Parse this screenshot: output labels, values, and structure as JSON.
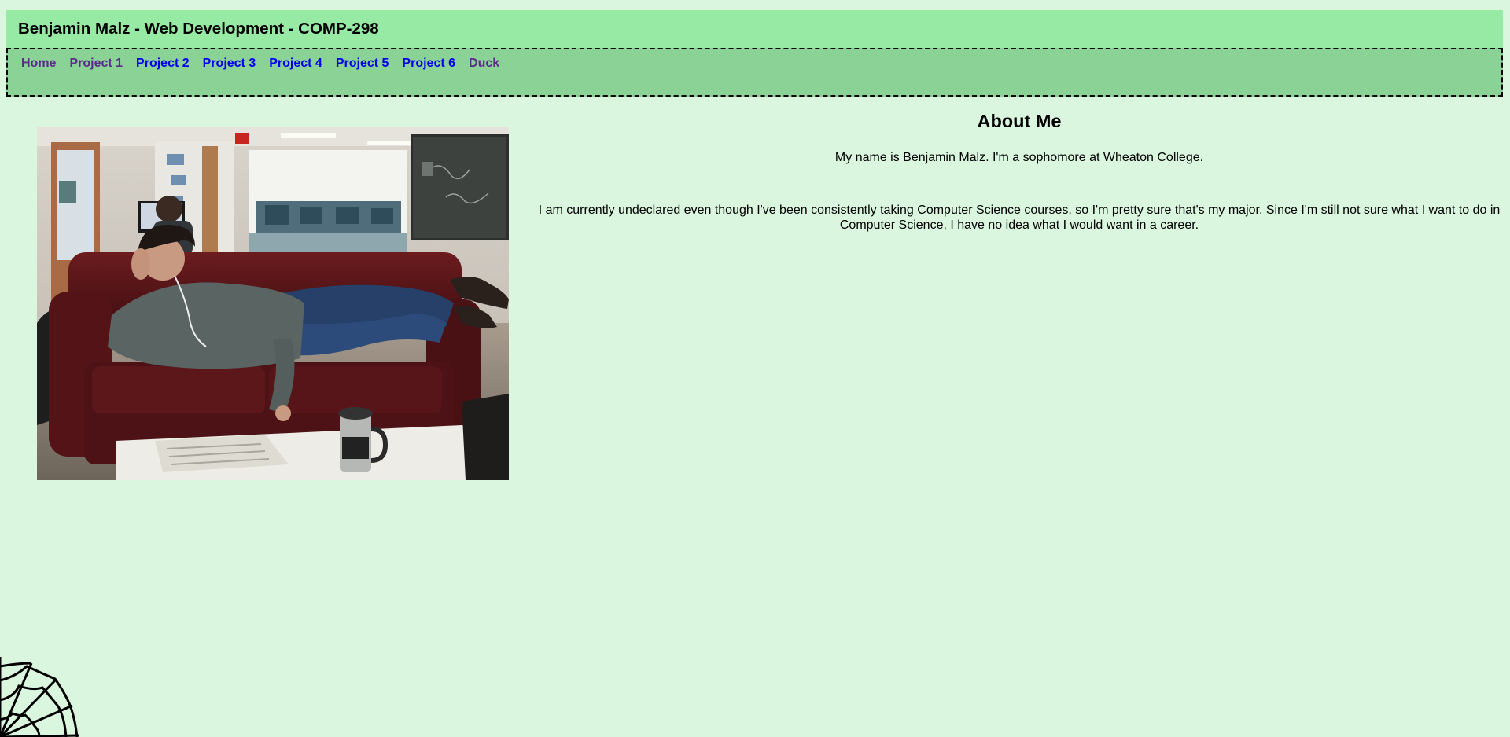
{
  "header": {
    "title": "Benjamin Malz - Web Development - COMP-298"
  },
  "nav": {
    "links": [
      {
        "label": "Home",
        "state": "visited"
      },
      {
        "label": "Project 1",
        "state": "visited"
      },
      {
        "label": "Project 2",
        "state": "unvisited"
      },
      {
        "label": "Project 3",
        "state": "unvisited"
      },
      {
        "label": "Project 4",
        "state": "unvisited"
      },
      {
        "label": "Project 5",
        "state": "unvisited"
      },
      {
        "label": "Project 6",
        "state": "unvisited"
      },
      {
        "label": "Duck",
        "state": "visited"
      }
    ]
  },
  "photo": {
    "icon": "profile-photo"
  },
  "about": {
    "title": "About Me",
    "paragraph1": "My name is Benjamin Malz. I'm a sophomore at Wheaton College.",
    "paragraph2": "I am currently undeclared even though I've been consistently taking Computer Science courses, so I'm pretty sure that's my major. Since I'm still not sure what I want to do in Computer Science, I have no idea what I would want in a career."
  },
  "decoration": {
    "icon": "spider-web-icon"
  },
  "colors": {
    "background": "#daf6df",
    "header": "#97eaa3",
    "nav": "#8bd297",
    "link": "#0000ee",
    "visited_link": "#5a2d8a"
  }
}
